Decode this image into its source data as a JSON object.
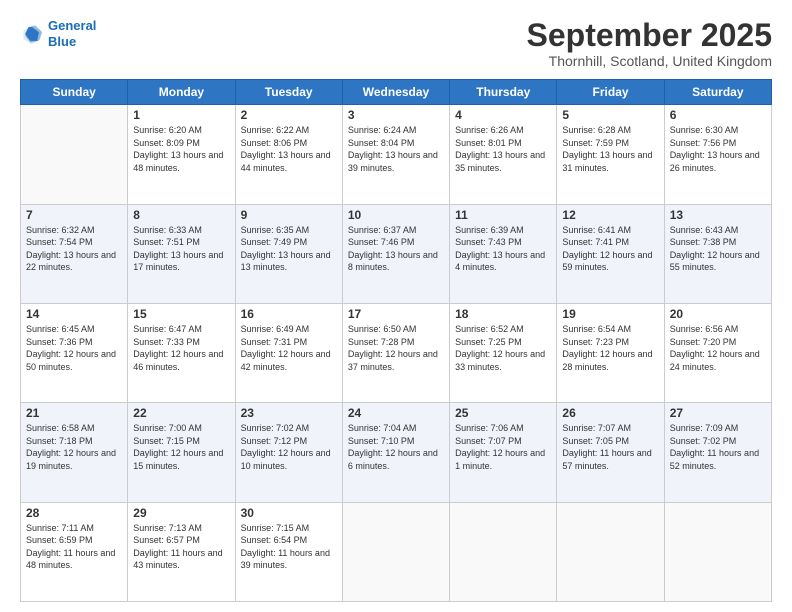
{
  "header": {
    "logo_line1": "General",
    "logo_line2": "Blue",
    "month_title": "September 2025",
    "location": "Thornhill, Scotland, United Kingdom"
  },
  "days_of_week": [
    "Sunday",
    "Monday",
    "Tuesday",
    "Wednesday",
    "Thursday",
    "Friday",
    "Saturday"
  ],
  "weeks": [
    [
      {
        "day": "",
        "sunrise": "",
        "sunset": "",
        "daylight": ""
      },
      {
        "day": "1",
        "sunrise": "Sunrise: 6:20 AM",
        "sunset": "Sunset: 8:09 PM",
        "daylight": "Daylight: 13 hours and 48 minutes."
      },
      {
        "day": "2",
        "sunrise": "Sunrise: 6:22 AM",
        "sunset": "Sunset: 8:06 PM",
        "daylight": "Daylight: 13 hours and 44 minutes."
      },
      {
        "day": "3",
        "sunrise": "Sunrise: 6:24 AM",
        "sunset": "Sunset: 8:04 PM",
        "daylight": "Daylight: 13 hours and 39 minutes."
      },
      {
        "day": "4",
        "sunrise": "Sunrise: 6:26 AM",
        "sunset": "Sunset: 8:01 PM",
        "daylight": "Daylight: 13 hours and 35 minutes."
      },
      {
        "day": "5",
        "sunrise": "Sunrise: 6:28 AM",
        "sunset": "Sunset: 7:59 PM",
        "daylight": "Daylight: 13 hours and 31 minutes."
      },
      {
        "day": "6",
        "sunrise": "Sunrise: 6:30 AM",
        "sunset": "Sunset: 7:56 PM",
        "daylight": "Daylight: 13 hours and 26 minutes."
      }
    ],
    [
      {
        "day": "7",
        "sunrise": "Sunrise: 6:32 AM",
        "sunset": "Sunset: 7:54 PM",
        "daylight": "Daylight: 13 hours and 22 minutes."
      },
      {
        "day": "8",
        "sunrise": "Sunrise: 6:33 AM",
        "sunset": "Sunset: 7:51 PM",
        "daylight": "Daylight: 13 hours and 17 minutes."
      },
      {
        "day": "9",
        "sunrise": "Sunrise: 6:35 AM",
        "sunset": "Sunset: 7:49 PM",
        "daylight": "Daylight: 13 hours and 13 minutes."
      },
      {
        "day": "10",
        "sunrise": "Sunrise: 6:37 AM",
        "sunset": "Sunset: 7:46 PM",
        "daylight": "Daylight: 13 hours and 8 minutes."
      },
      {
        "day": "11",
        "sunrise": "Sunrise: 6:39 AM",
        "sunset": "Sunset: 7:43 PM",
        "daylight": "Daylight: 13 hours and 4 minutes."
      },
      {
        "day": "12",
        "sunrise": "Sunrise: 6:41 AM",
        "sunset": "Sunset: 7:41 PM",
        "daylight": "Daylight: 12 hours and 59 minutes."
      },
      {
        "day": "13",
        "sunrise": "Sunrise: 6:43 AM",
        "sunset": "Sunset: 7:38 PM",
        "daylight": "Daylight: 12 hours and 55 minutes."
      }
    ],
    [
      {
        "day": "14",
        "sunrise": "Sunrise: 6:45 AM",
        "sunset": "Sunset: 7:36 PM",
        "daylight": "Daylight: 12 hours and 50 minutes."
      },
      {
        "day": "15",
        "sunrise": "Sunrise: 6:47 AM",
        "sunset": "Sunset: 7:33 PM",
        "daylight": "Daylight: 12 hours and 46 minutes."
      },
      {
        "day": "16",
        "sunrise": "Sunrise: 6:49 AM",
        "sunset": "Sunset: 7:31 PM",
        "daylight": "Daylight: 12 hours and 42 minutes."
      },
      {
        "day": "17",
        "sunrise": "Sunrise: 6:50 AM",
        "sunset": "Sunset: 7:28 PM",
        "daylight": "Daylight: 12 hours and 37 minutes."
      },
      {
        "day": "18",
        "sunrise": "Sunrise: 6:52 AM",
        "sunset": "Sunset: 7:25 PM",
        "daylight": "Daylight: 12 hours and 33 minutes."
      },
      {
        "day": "19",
        "sunrise": "Sunrise: 6:54 AM",
        "sunset": "Sunset: 7:23 PM",
        "daylight": "Daylight: 12 hours and 28 minutes."
      },
      {
        "day": "20",
        "sunrise": "Sunrise: 6:56 AM",
        "sunset": "Sunset: 7:20 PM",
        "daylight": "Daylight: 12 hours and 24 minutes."
      }
    ],
    [
      {
        "day": "21",
        "sunrise": "Sunrise: 6:58 AM",
        "sunset": "Sunset: 7:18 PM",
        "daylight": "Daylight: 12 hours and 19 minutes."
      },
      {
        "day": "22",
        "sunrise": "Sunrise: 7:00 AM",
        "sunset": "Sunset: 7:15 PM",
        "daylight": "Daylight: 12 hours and 15 minutes."
      },
      {
        "day": "23",
        "sunrise": "Sunrise: 7:02 AM",
        "sunset": "Sunset: 7:12 PM",
        "daylight": "Daylight: 12 hours and 10 minutes."
      },
      {
        "day": "24",
        "sunrise": "Sunrise: 7:04 AM",
        "sunset": "Sunset: 7:10 PM",
        "daylight": "Daylight: 12 hours and 6 minutes."
      },
      {
        "day": "25",
        "sunrise": "Sunrise: 7:06 AM",
        "sunset": "Sunset: 7:07 PM",
        "daylight": "Daylight: 12 hours and 1 minute."
      },
      {
        "day": "26",
        "sunrise": "Sunrise: 7:07 AM",
        "sunset": "Sunset: 7:05 PM",
        "daylight": "Daylight: 11 hours and 57 minutes."
      },
      {
        "day": "27",
        "sunrise": "Sunrise: 7:09 AM",
        "sunset": "Sunset: 7:02 PM",
        "daylight": "Daylight: 11 hours and 52 minutes."
      }
    ],
    [
      {
        "day": "28",
        "sunrise": "Sunrise: 7:11 AM",
        "sunset": "Sunset: 6:59 PM",
        "daylight": "Daylight: 11 hours and 48 minutes."
      },
      {
        "day": "29",
        "sunrise": "Sunrise: 7:13 AM",
        "sunset": "Sunset: 6:57 PM",
        "daylight": "Daylight: 11 hours and 43 minutes."
      },
      {
        "day": "30",
        "sunrise": "Sunrise: 7:15 AM",
        "sunset": "Sunset: 6:54 PM",
        "daylight": "Daylight: 11 hours and 39 minutes."
      },
      {
        "day": "",
        "sunrise": "",
        "sunset": "",
        "daylight": ""
      },
      {
        "day": "",
        "sunrise": "",
        "sunset": "",
        "daylight": ""
      },
      {
        "day": "",
        "sunrise": "",
        "sunset": "",
        "daylight": ""
      },
      {
        "day": "",
        "sunrise": "",
        "sunset": "",
        "daylight": ""
      }
    ]
  ]
}
